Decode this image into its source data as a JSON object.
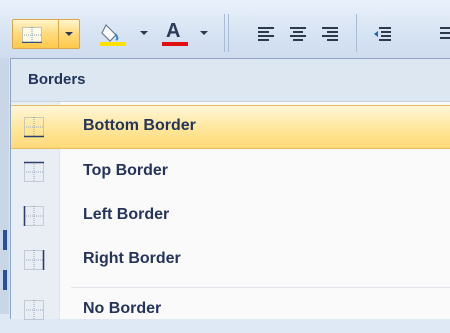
{
  "toolbar": {
    "borders_button": "borders-icon",
    "fill_button": "paint-bucket-icon",
    "font_color_button": {
      "label": "A",
      "icon": "font-color-icon",
      "color": "#e01010"
    },
    "fill_color": "#ffe000",
    "align_left": "align-left-icon",
    "align_center": "align-center-icon",
    "align_right": "align-right-icon",
    "decrease_indent": "decrease-indent-icon"
  },
  "menu": {
    "header": "Borders",
    "items": [
      {
        "label": "Bottom Border",
        "icon": "bottom-border-icon",
        "highlighted": true
      },
      {
        "label": "Top Border",
        "icon": "top-border-icon"
      },
      {
        "label": "Left Border",
        "icon": "left-border-icon"
      },
      {
        "label": "Right Border",
        "icon": "right-border-icon"
      },
      {
        "label": "No Border",
        "icon": "no-border-icon"
      }
    ]
  },
  "colors": {
    "highlight": "#ffd978",
    "header_text": "#23355a",
    "item_text": "#25345a"
  }
}
